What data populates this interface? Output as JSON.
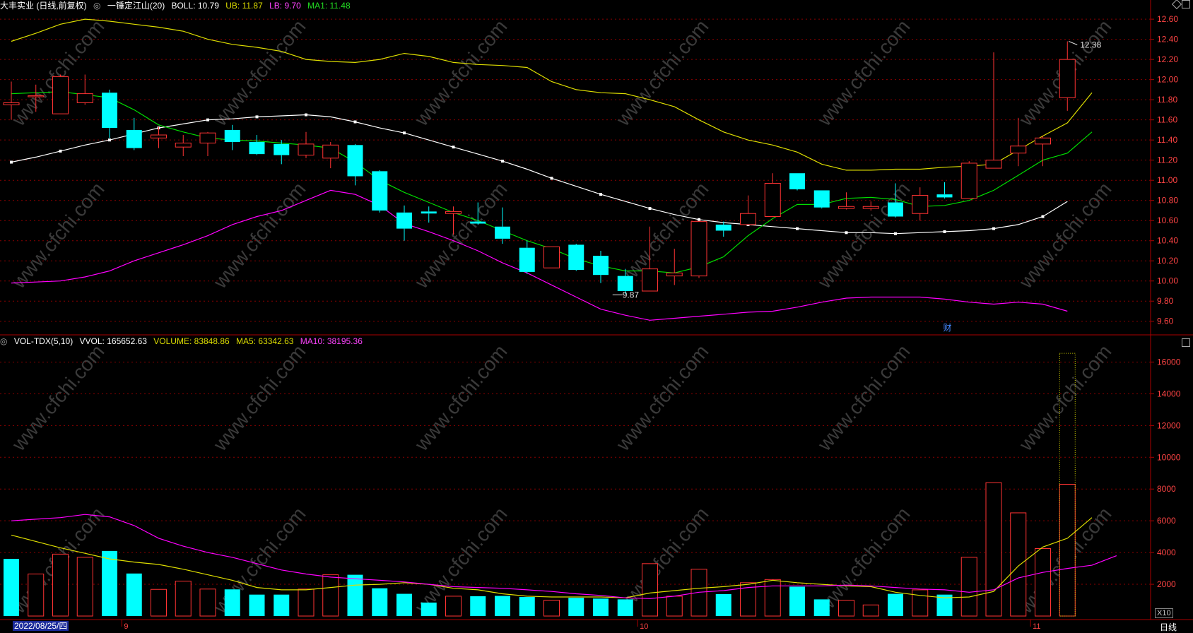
{
  "header": {
    "stock_name": "大丰实业 (日线,前复权)",
    "indicator_name": "一锤定江山(20)",
    "boll_label": "BOLL: 10.79",
    "ub_label": "UB: 11.87",
    "lb_label": "LB: 9.70",
    "ma1_label": "MA1: 11.48"
  },
  "volume_header": {
    "indicator_name": "VOL-TDX(5,10)",
    "vvol_label": "VVOL: 165652.63",
    "volume_label": "VOLUME: 83848.86",
    "ma5_label": "MA5: 63342.63",
    "ma10_label": "MA10: 38195.36"
  },
  "footer": {
    "date_label": "2022/08/25/四",
    "period_label": "日线",
    "multiplier_label": "X10",
    "month_labels": [
      "9",
      "10",
      "11"
    ]
  },
  "annotations": {
    "high_label": "12.38",
    "low_label": "9.87",
    "finance_marker": "财"
  },
  "watermark": "www.cfchi.com",
  "colors": {
    "up": "#ff3333",
    "down": "#00ffff",
    "boll_mid": "#ffffff",
    "ub": "#dddd00",
    "lb": "#ff00ff",
    "ma1": "#00dd00",
    "ma5": "#dddd00",
    "ma10": "#ff00ff",
    "grid": "#8b0000",
    "axis_text": "#ff4444"
  },
  "chart_data": [
    {
      "type": "candlestick",
      "title": "大丰实业 (日线,前复权)",
      "ylim": [
        9.5,
        12.65
      ],
      "y_ticks": [
        9.6,
        9.8,
        10.0,
        10.2,
        10.4,
        10.6,
        10.8,
        11.0,
        11.2,
        11.4,
        11.6,
        11.8,
        12.0,
        12.2,
        12.4,
        12.6
      ],
      "x_month_markers": [
        {
          "index": 5,
          "label": "9"
        },
        {
          "index": 26,
          "label": "10"
        },
        {
          "index": 42,
          "label": "11"
        }
      ],
      "candles": [
        {
          "o": 11.75,
          "c": 11.77,
          "h": 11.98,
          "l": 11.6
        },
        {
          "o": 11.84,
          "c": 11.84,
          "h": 11.95,
          "l": 11.68
        },
        {
          "o": 11.66,
          "c": 12.03,
          "h": 12.05,
          "l": 11.66
        },
        {
          "o": 11.77,
          "c": 11.86,
          "h": 12.05,
          "l": 11.75
        },
        {
          "o": 11.87,
          "c": 11.52,
          "h": 11.9,
          "l": 11.42
        },
        {
          "o": 11.5,
          "c": 11.32,
          "h": 11.62,
          "l": 11.3
        },
        {
          "o": 11.42,
          "c": 11.45,
          "h": 11.53,
          "l": 11.32
        },
        {
          "o": 11.33,
          "c": 11.37,
          "h": 11.45,
          "l": 11.24
        },
        {
          "o": 11.37,
          "c": 11.47,
          "h": 11.48,
          "l": 11.24
        },
        {
          "o": 11.5,
          "c": 11.38,
          "h": 11.55,
          "l": 11.3
        },
        {
          "o": 11.38,
          "c": 11.26,
          "h": 11.45,
          "l": 11.25
        },
        {
          "o": 11.36,
          "c": 11.25,
          "h": 11.4,
          "l": 11.16
        },
        {
          "o": 11.25,
          "c": 11.36,
          "h": 11.48,
          "l": 11.22
        },
        {
          "o": 11.22,
          "c": 11.35,
          "h": 11.38,
          "l": 11.12
        },
        {
          "o": 11.35,
          "c": 11.04,
          "h": 11.36,
          "l": 10.95
        },
        {
          "o": 11.09,
          "c": 10.7,
          "h": 11.1,
          "l": 10.68
        },
        {
          "o": 10.68,
          "c": 10.52,
          "h": 10.75,
          "l": 10.4
        },
        {
          "o": 10.69,
          "c": 10.67,
          "h": 10.74,
          "l": 10.58
        },
        {
          "o": 10.67,
          "c": 10.69,
          "h": 10.74,
          "l": 10.46
        },
        {
          "o": 10.59,
          "c": 10.57,
          "h": 10.78,
          "l": 10.56
        },
        {
          "o": 10.54,
          "c": 10.42,
          "h": 10.73,
          "l": 10.37
        },
        {
          "o": 10.33,
          "c": 10.09,
          "h": 10.4,
          "l": 10.07
        },
        {
          "o": 10.13,
          "c": 10.34,
          "h": 10.34,
          "l": 10.13
        },
        {
          "o": 10.36,
          "c": 10.11,
          "h": 10.37,
          "l": 10.1
        },
        {
          "o": 10.25,
          "c": 10.06,
          "h": 10.3,
          "l": 9.98
        },
        {
          "o": 10.05,
          "c": 9.9,
          "h": 10.12,
          "l": 9.87
        },
        {
          "o": 9.9,
          "c": 10.12,
          "h": 10.54,
          "l": 9.9
        },
        {
          "o": 10.05,
          "c": 10.08,
          "h": 10.32,
          "l": 9.96
        },
        {
          "o": 10.05,
          "c": 10.59,
          "h": 10.6,
          "l": 10.03
        },
        {
          "o": 10.56,
          "c": 10.5,
          "h": 10.59,
          "l": 10.44
        },
        {
          "o": 10.56,
          "c": 10.67,
          "h": 10.85,
          "l": 10.56
        },
        {
          "o": 10.64,
          "c": 10.97,
          "h": 11.07,
          "l": 10.64
        },
        {
          "o": 11.07,
          "c": 10.91,
          "h": 11.07,
          "l": 10.9
        },
        {
          "o": 10.9,
          "c": 10.73,
          "h": 10.9,
          "l": 10.72
        },
        {
          "o": 10.72,
          "c": 10.74,
          "h": 10.88,
          "l": 10.71
        },
        {
          "o": 10.72,
          "c": 10.74,
          "h": 10.79,
          "l": 10.7
        },
        {
          "o": 10.78,
          "c": 10.64,
          "h": 10.97,
          "l": 10.63
        },
        {
          "o": 10.67,
          "c": 10.85,
          "h": 10.93,
          "l": 10.6
        },
        {
          "o": 10.86,
          "c": 10.83,
          "h": 10.98,
          "l": 10.82
        },
        {
          "o": 10.82,
          "c": 11.17,
          "h": 11.19,
          "l": 10.82
        },
        {
          "o": 11.12,
          "c": 11.2,
          "h": 12.27,
          "l": 11.12
        },
        {
          "o": 11.27,
          "c": 11.34,
          "h": 11.62,
          "l": 11.14
        },
        {
          "o": 11.36,
          "c": 11.42,
          "h": 11.44,
          "l": 11.14
        },
        {
          "o": 11.82,
          "c": 12.2,
          "h": 12.38,
          "l": 11.69
        }
      ],
      "series": [
        {
          "name": "BOLL",
          "values": [
            11.18,
            11.23,
            11.29,
            11.35,
            11.4,
            11.46,
            11.52,
            11.56,
            11.6,
            11.61,
            11.63,
            11.64,
            11.65,
            11.63,
            11.58,
            11.52,
            11.47,
            11.4,
            11.33,
            11.26,
            11.19,
            11.11,
            11.02,
            10.94,
            10.86,
            10.79,
            10.72,
            10.66,
            10.61,
            10.58,
            10.56,
            10.54,
            10.52,
            10.5,
            10.48,
            10.48,
            10.47,
            10.48,
            10.49,
            10.5,
            10.52,
            10.56,
            10.64,
            10.79
          ]
        },
        {
          "name": "UB",
          "values": [
            12.38,
            12.46,
            12.55,
            12.6,
            12.58,
            12.55,
            12.52,
            12.48,
            12.4,
            12.35,
            12.32,
            12.28,
            12.2,
            12.18,
            12.17,
            12.2,
            12.26,
            12.23,
            12.17,
            12.15,
            12.14,
            12.12,
            11.98,
            11.9,
            11.87,
            11.86,
            11.8,
            11.73,
            11.6,
            11.48,
            11.4,
            11.35,
            11.28,
            11.16,
            11.1,
            11.1,
            11.11,
            11.11,
            11.13,
            11.14,
            11.16,
            11.3,
            11.44,
            11.57,
            11.87
          ]
        },
        {
          "name": "LB",
          "values": [
            9.98,
            9.99,
            10.0,
            10.04,
            10.1,
            10.2,
            10.28,
            10.36,
            10.45,
            10.56,
            10.64,
            10.7,
            10.8,
            10.9,
            10.86,
            10.75,
            10.57,
            10.49,
            10.4,
            10.3,
            10.18,
            10.08,
            9.96,
            9.84,
            9.72,
            9.66,
            9.61,
            9.63,
            9.65,
            9.67,
            9.69,
            9.7,
            9.74,
            9.79,
            9.83,
            9.84,
            9.84,
            9.84,
            9.82,
            9.79,
            9.77,
            9.79,
            9.77,
            9.7
          ]
        },
        {
          "name": "MA1",
          "values": [
            11.86,
            11.87,
            11.88,
            11.85,
            11.82,
            11.7,
            11.55,
            11.48,
            11.42,
            11.4,
            11.39,
            11.37,
            11.35,
            11.32,
            11.18,
            11.0,
            10.88,
            10.78,
            10.68,
            10.6,
            10.5,
            10.4,
            10.32,
            10.22,
            10.15,
            10.1,
            10.1,
            10.08,
            10.14,
            10.24,
            10.45,
            10.62,
            10.76,
            10.76,
            10.82,
            10.83,
            10.81,
            10.74,
            10.75,
            10.8,
            10.9,
            11.05,
            11.2,
            11.27,
            11.48
          ]
        }
      ]
    },
    {
      "type": "bar",
      "title": "VOL-TDX(5,10)",
      "ylim": [
        0,
        17000
      ],
      "y_ticks": [
        2000,
        4000,
        6000,
        8000,
        10000,
        12000,
        14000,
        16000
      ],
      "multiplier": "X10",
      "values": [
        3600,
        2650,
        3900,
        3700,
        4100,
        2680,
        1680,
        2200,
        1700,
        1680,
        1350,
        1350,
        1700,
        2600,
        2600,
        1750,
        1400,
        850,
        1250,
        1250,
        1270,
        1200,
        1000,
        1150,
        1100,
        1050,
        3300,
        1250,
        2950,
        1380,
        2100,
        2300,
        1850,
        1050,
        1000,
        700,
        1400,
        1650,
        1350,
        3700,
        8400,
        6500,
        4250,
        8300
      ],
      "directions": [
        "down",
        "up",
        "up",
        "up",
        "down",
        "down",
        "up",
        "up",
        "up",
        "down",
        "down",
        "down",
        "up",
        "up",
        "down",
        "down",
        "down",
        "down",
        "up",
        "down",
        "down",
        "down",
        "up",
        "down",
        "down",
        "down",
        "up",
        "up",
        "up",
        "down",
        "up",
        "up",
        "down",
        "down",
        "up",
        "up",
        "down",
        "up",
        "down",
        "up",
        "up",
        "up",
        "up",
        "up"
      ],
      "vvol_value": 16550,
      "series": [
        {
          "name": "MA5",
          "values": [
            5100,
            4700,
            4300,
            3950,
            3600,
            3400,
            3250,
            2950,
            2600,
            2250,
            1800,
            1650,
            1650,
            1800,
            1950,
            2000,
            2100,
            2000,
            1750,
            1650,
            1400,
            1250,
            1200,
            1200,
            1200,
            1150,
            1450,
            1600,
            1750,
            1850,
            2000,
            2250,
            2100,
            2000,
            1900,
            1850,
            1500,
            1300,
            1150,
            1200,
            1550,
            3150,
            4350,
            4900,
            6200
          ]
        },
        {
          "name": "MA10",
          "values": [
            6000,
            6100,
            6200,
            6400,
            6250,
            5700,
            4900,
            4400,
            4000,
            3700,
            3300,
            2900,
            2650,
            2450,
            2350,
            2250,
            2150,
            2000,
            1850,
            1800,
            1750,
            1650,
            1550,
            1400,
            1300,
            1150,
            1100,
            1250,
            1500,
            1600,
            1800,
            1900,
            1900,
            1900,
            1950,
            1900,
            1800,
            1700,
            1650,
            1500,
            1650,
            2400,
            2750,
            3000,
            3200,
            3800
          ]
        }
      ]
    }
  ]
}
